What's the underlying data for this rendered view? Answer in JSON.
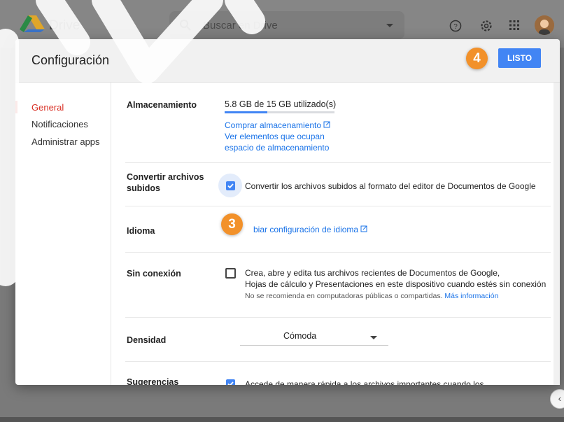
{
  "app": {
    "name": "Drive",
    "search_placeholder": "Buscar en Drive",
    "icons": [
      "help-icon",
      "settings-icon",
      "apps-grid-icon",
      "avatar"
    ]
  },
  "dialog": {
    "title": "Configuración",
    "done_label": "LISTO"
  },
  "callouts": {
    "step3": "3",
    "step4": "4"
  },
  "sidebar": {
    "items": [
      {
        "label": "General",
        "active": true
      },
      {
        "label": "Notificaciones",
        "active": false
      },
      {
        "label": "Administrar apps",
        "active": false
      }
    ]
  },
  "settings": {
    "storage": {
      "label": "Almacenamiento",
      "usage": "5.8 GB de 15 GB utilizado(s)",
      "used_fraction": 0.387,
      "buy_link": "Comprar almacenamiento",
      "view_link_line1": "Ver elementos que ocupan",
      "view_link_line2": "espacio de almacenamiento"
    },
    "convert": {
      "label_line1": "Convertir archivos",
      "label_line2": "subidos",
      "checked": true,
      "text": "Convertir los archivos subidos al formato del editor de Documentos de Google"
    },
    "language": {
      "label": "Idioma",
      "link": "biar configuración de idioma"
    },
    "offline": {
      "label": "Sin conexión",
      "checked": false,
      "line1": "Crea, abre y edita tus archivos recientes de Documentos de Google,",
      "line2": "Hojas de cálculo y Presentaciones en este dispositivo cuando estés sin conexión",
      "note": "No se recomienda en computadoras públicas o compartidas.",
      "more_link": "Más información"
    },
    "density": {
      "label": "Densidad",
      "value": "Cómoda"
    },
    "suggestions": {
      "label": "Sugerencias",
      "checked": true,
      "text": "Accede de manera rápida a los archivos importantes cuando los"
    }
  },
  "colors": {
    "accent": "#4285f4",
    "active_nav": "#d93025",
    "callout": "#f2912a"
  }
}
